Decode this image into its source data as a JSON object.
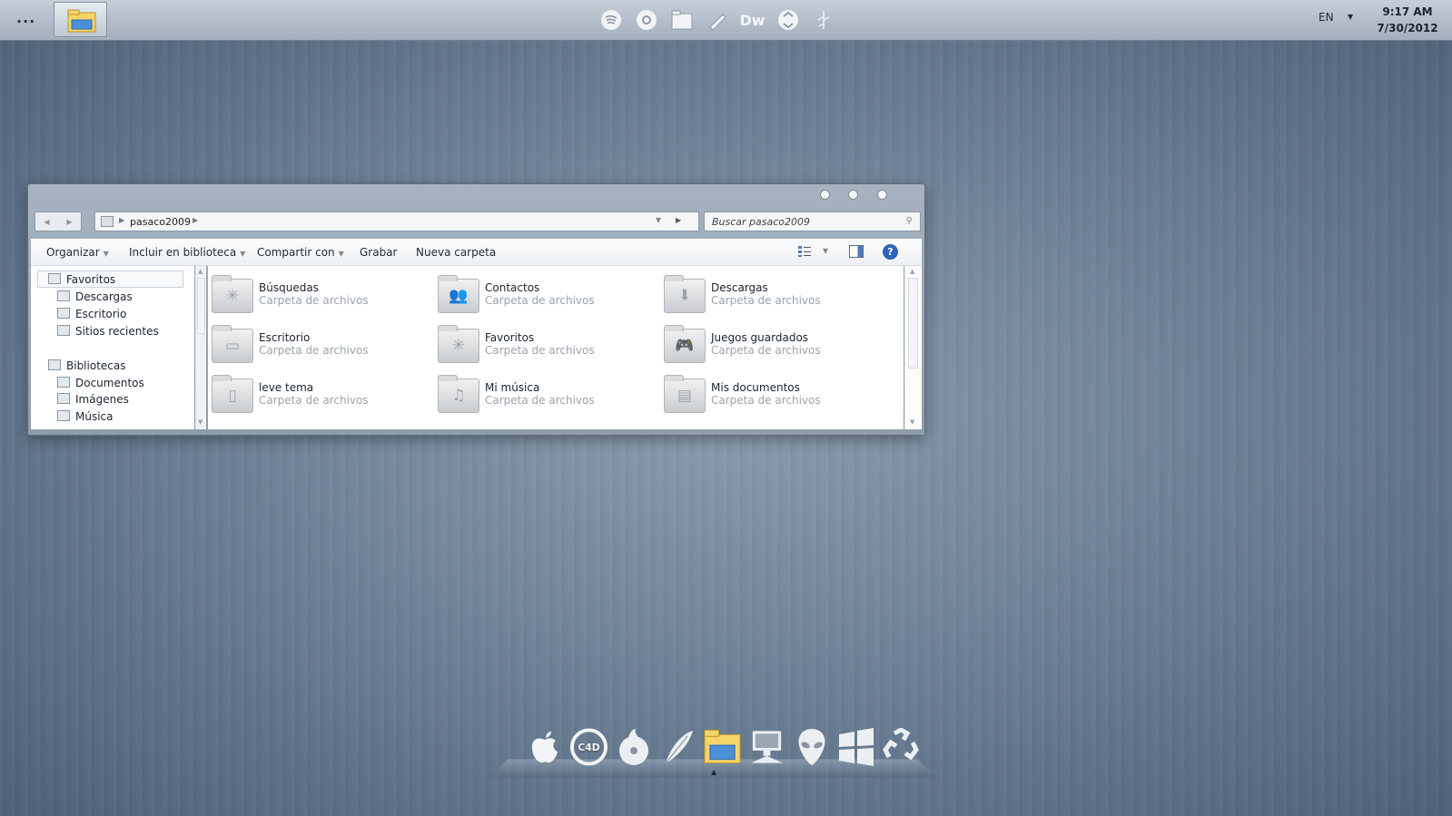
{
  "topbar": {
    "menu_label": "...",
    "tray_icons": [
      "spotify-icon",
      "chrome-icon",
      "folder-icon",
      "pencil-icon",
      "dreamweaver-icon",
      "recycle-icon",
      "feather-icon"
    ],
    "dreamweaver_label": "Dw",
    "language": "EN",
    "time": "9:17 AM",
    "date": "7/30/2012"
  },
  "window": {
    "address": {
      "crumb": "pasaco2009"
    },
    "search": {
      "placeholder": "Buscar pasaco2009"
    },
    "commands": {
      "organizar": "Organizar",
      "incluir": "Incluir en biblioteca",
      "compartir": "Compartir con",
      "grabar": "Grabar",
      "nueva_carpeta": "Nueva carpeta"
    },
    "help_label": "?",
    "nav": {
      "favoritos": "Favoritos",
      "descargas": "Descargas",
      "escritorio": "Escritorio",
      "sitios_recientes": "Sitios recientes",
      "bibliotecas": "Bibliotecas",
      "documentos": "Documentos",
      "imagenes": "Imágenes",
      "musica": "Música"
    },
    "items": [
      {
        "name": "Búsquedas",
        "type": "Carpeta de archivos",
        "glyph": "✳"
      },
      {
        "name": "Contactos",
        "type": "Carpeta de archivos",
        "glyph": "👥"
      },
      {
        "name": "Descargas",
        "type": "Carpeta de archivos",
        "glyph": "⬇"
      },
      {
        "name": "Escritorio",
        "type": "Carpeta de archivos",
        "glyph": "▭"
      },
      {
        "name": "Favoritos",
        "type": "Carpeta de archivos",
        "glyph": "✳"
      },
      {
        "name": "Juegos guardados",
        "type": "Carpeta de archivos",
        "glyph": "🎮"
      },
      {
        "name": "leve tema",
        "type": "Carpeta de archivos",
        "glyph": "▯"
      },
      {
        "name": "Mi música",
        "type": "Carpeta de archivos",
        "glyph": "♫"
      },
      {
        "name": "Mis documentos",
        "type": "Carpeta de archivos",
        "glyph": "▤"
      }
    ]
  },
  "dock": {
    "items": [
      "apple-icon",
      "cinema4d-icon",
      "burner-disc-icon",
      "feather-icon",
      "explorer-folder-icon",
      "network-computer-icon",
      "alien-icon",
      "windows-logo-icon",
      "recycle-bin-icon"
    ],
    "c4d_label": "C4D"
  }
}
